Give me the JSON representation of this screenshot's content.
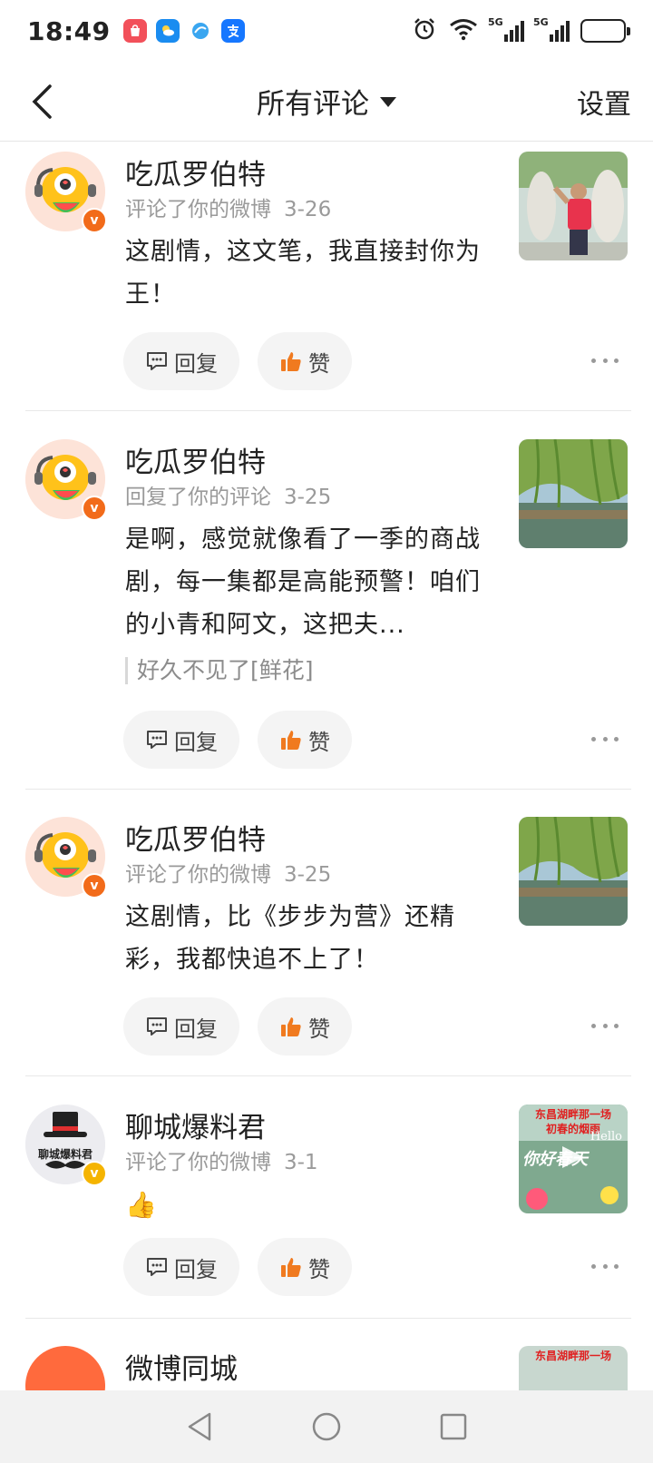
{
  "status_bar": {
    "time": "18:49",
    "network_label_1": "5G",
    "network_label_2": "5G"
  },
  "header": {
    "title": "所有评论",
    "settings_label": "设置"
  },
  "comments": [
    {
      "author": "吃瓜罗伯特",
      "action": "评论了你的微博",
      "date": "3-26",
      "text": "这剧情，这文笔，我直接封你为王！",
      "quote": "",
      "reply_label": "回复",
      "like_label": "赞"
    },
    {
      "author": "吃瓜罗伯特",
      "action": "回复了你的评论",
      "date": "3-25",
      "text": "是啊，感觉就像看了一季的商战剧，每一集都是高能预警！咱们的小青和阿文，这把夫...",
      "quote": "好久不见了[鲜花]",
      "reply_label": "回复",
      "like_label": "赞"
    },
    {
      "author": "吃瓜罗伯特",
      "action": "评论了你的微博",
      "date": "3-25",
      "text": "这剧情，比《步步为营》还精彩，我都快追不上了！",
      "quote": "",
      "reply_label": "回复",
      "like_label": "赞"
    },
    {
      "author": "聊城爆料君",
      "action": "评论了你的微博",
      "date": "3-1",
      "text": "👍",
      "quote": "",
      "reply_label": "回复",
      "like_label": "赞",
      "avatar_text": "聊城爆料君",
      "thumb_text_1": "东昌湖畔那一场",
      "thumb_text_2": "初春的烟雨",
      "thumb_text_3": "你好春天",
      "thumb_text_4": "Hello"
    },
    {
      "author": "微博同城",
      "thumb_text_1": "东昌湖畔那一场"
    }
  ],
  "colors": {
    "like_orange": "#f07a1f",
    "verified_orange": "#f26b1a",
    "verified_yellow": "#f5b400"
  }
}
